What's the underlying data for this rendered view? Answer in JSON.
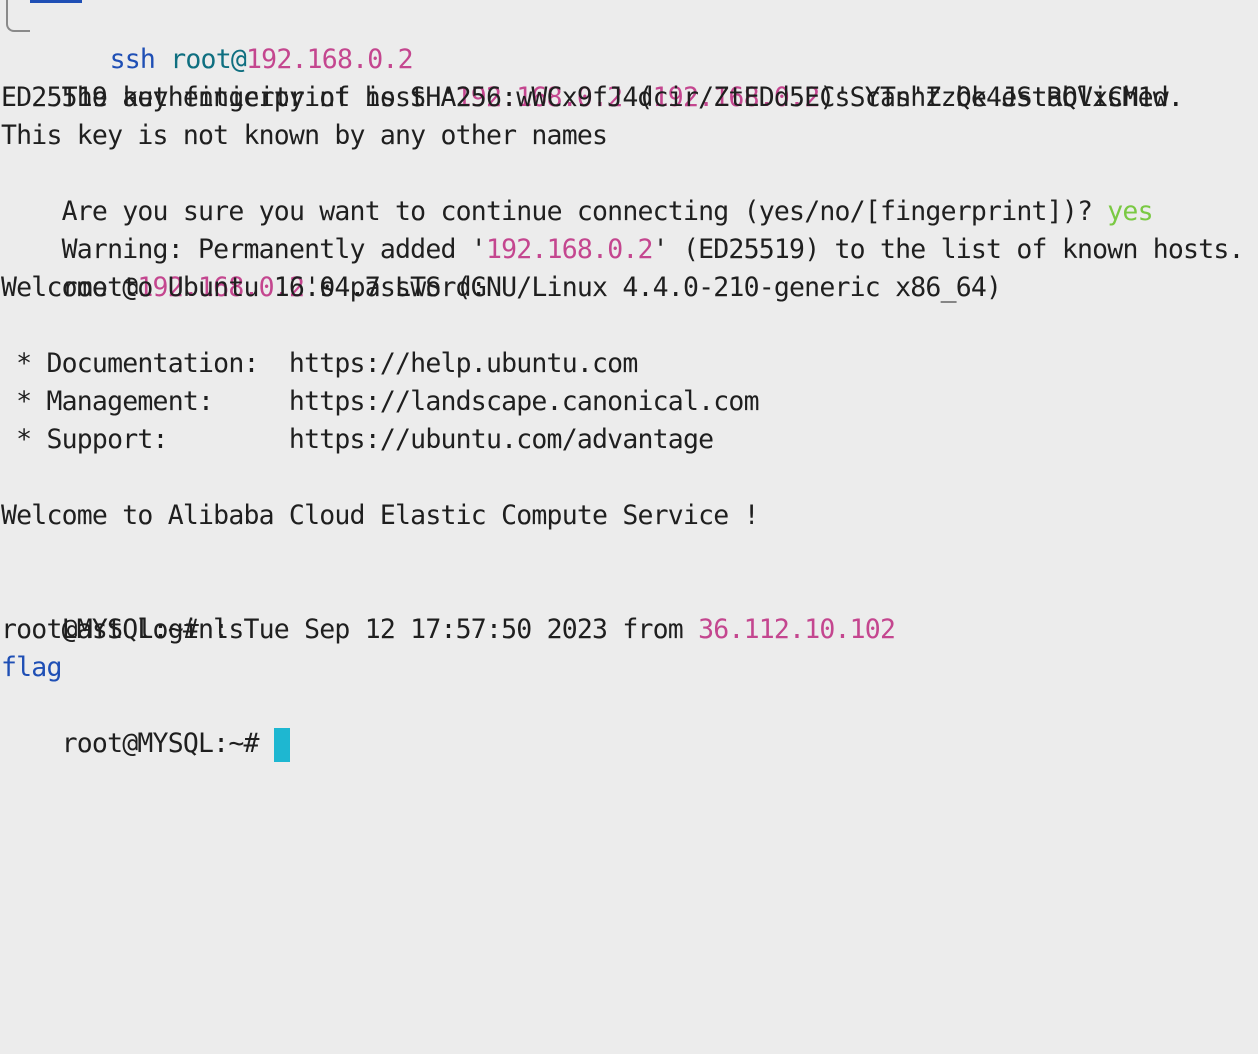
{
  "terminal": {
    "l1": {
      "cmd": "ssh",
      "sp": " ",
      "user": "root@",
      "host": "192.168.0.2"
    },
    "l2": {
      "a": "The authenticity of host '",
      "ip1": "192.168.0.2",
      "b": " (",
      "ip2": "192.168.0.2",
      "c": ")' can't be established."
    },
    "l3": {
      "text": "ED25519 key fingerprint is SHA256:wWCx9fJ4dcir/ZtEDd5ECsSYTshZzQk4JStRQVxCM1w."
    },
    "l4": {
      "text": "This key is not known by any other names"
    },
    "l5": {
      "text": "Are you sure you want to continue connecting (yes/no/[fingerprint])? ",
      "answer": "yes"
    },
    "l6": {
      "a": "Warning: Permanently added '",
      "ip": "192.168.0.2",
      "b": "' (ED25519) to the list of known hosts."
    },
    "l7": {
      "a": "root@",
      "ip": "192.168.0.2",
      "b": "'s password:"
    },
    "l8": {
      "text": "Welcome to Ubuntu 16.04.7 LTS (GNU/Linux 4.4.0-210-generic x86_64)"
    },
    "l10": {
      "text": " * Documentation:  https://help.ubuntu.com"
    },
    "l11": {
      "text": " * Management:     https://landscape.canonical.com"
    },
    "l12": {
      "text": " * Support:        https://ubuntu.com/advantage"
    },
    "l14": {
      "text": "Welcome to Alibaba Cloud Elastic Compute Service !"
    },
    "l16": {
      "a": "Last login: Tue Sep 12 17:57:50 2023 from ",
      "ip": "36.112.10.102"
    },
    "l17": {
      "text": "root@MYSQL:~# ls"
    },
    "l18": {
      "text": "flag"
    },
    "l19": {
      "prompt": "root@MYSQL:~# "
    }
  },
  "colors": {
    "background": "#ececec",
    "text": "#1f1f1f",
    "ip": "#c4468f",
    "answer": "#7ac943",
    "command": "#1f4fb5",
    "user": "#0f6f80",
    "directory": "#1f4fb5",
    "cursor": "#1eb7d1"
  }
}
